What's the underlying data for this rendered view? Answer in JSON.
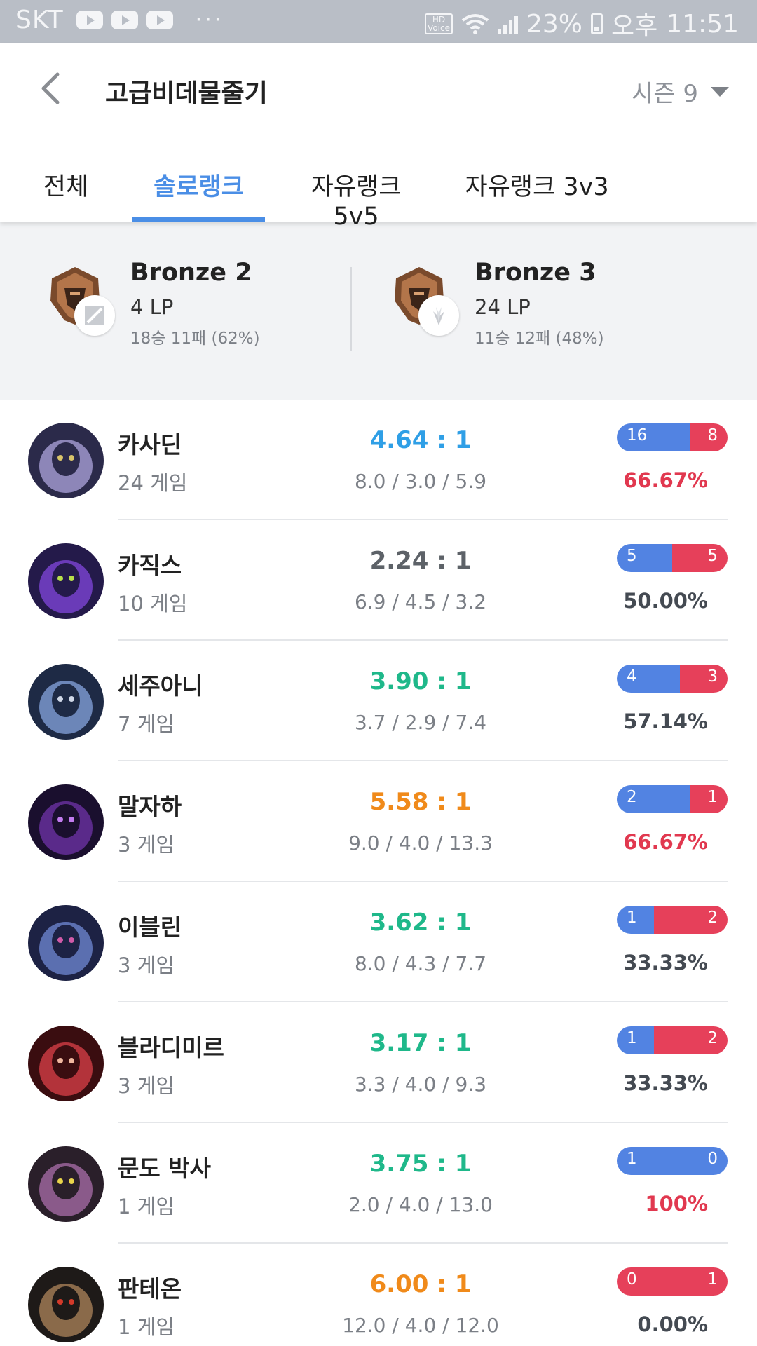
{
  "status_bar": {
    "carrier": "SKT",
    "more": "···",
    "hd_top": "HD",
    "hd_bottom": "Voice",
    "battery": "23%",
    "ampm": "오후",
    "time": "11:51"
  },
  "header": {
    "summoner_name": "고급비데물줄기",
    "season": "시즌 9"
  },
  "tabs": [
    {
      "label": "전체",
      "active": false
    },
    {
      "label": "솔로랭크",
      "active": true
    },
    {
      "label": "자유랭크 5v5",
      "active": false
    },
    {
      "label": "자유랭크 3v3",
      "active": false
    }
  ],
  "tiers": [
    {
      "name": "Bronze 2",
      "lp": "4 LP",
      "record": "18승 11패 (62%)",
      "queue_icon": "solo-queue-icon"
    },
    {
      "name": "Bronze 3",
      "lp": "24 LP",
      "record": "11승 12패 (48%)",
      "queue_icon": "flex-queue-icon"
    }
  ],
  "colors": {
    "accent": "#4a8ee6",
    "win": "#5283e2",
    "loss": "#e6405a",
    "kda_blue": "#2f9fe6",
    "kda_gray": "#5d6268",
    "kda_green": "#1fb88a",
    "kda_orange": "#f08a1a",
    "rate_red": "#e1384f",
    "rate_dark": "#444a52"
  },
  "champions": [
    {
      "name": "카사딘",
      "games": "24 게임",
      "kda_ratio": "4.64 : 1",
      "kda_color": "#2f9fe6",
      "kda": "8.0 / 3.0 / 5.9",
      "wins": 16,
      "losses": 8,
      "win_rate": "66.67%",
      "rate_color": "#e1384f",
      "avatar": "kassadin-portrait"
    },
    {
      "name": "카직스",
      "games": "10 게임",
      "kda_ratio": "2.24 : 1",
      "kda_color": "#5d6268",
      "kda": "6.9 / 4.5 / 3.2",
      "wins": 5,
      "losses": 5,
      "win_rate": "50.00%",
      "rate_color": "#444a52",
      "avatar": "khazix-portrait"
    },
    {
      "name": "세주아니",
      "games": "7 게임",
      "kda_ratio": "3.90 : 1",
      "kda_color": "#1fb88a",
      "kda": "3.7 / 2.9 / 7.4",
      "wins": 4,
      "losses": 3,
      "win_rate": "57.14%",
      "rate_color": "#444a52",
      "avatar": "sejuani-portrait"
    },
    {
      "name": "말자하",
      "games": "3 게임",
      "kda_ratio": "5.58 : 1",
      "kda_color": "#f08a1a",
      "kda": "9.0 / 4.0 / 13.3",
      "wins": 2,
      "losses": 1,
      "win_rate": "66.67%",
      "rate_color": "#e1384f",
      "avatar": "malzahar-portrait"
    },
    {
      "name": "이블린",
      "games": "3 게임",
      "kda_ratio": "3.62 : 1",
      "kda_color": "#1fb88a",
      "kda": "8.0 / 4.3 / 7.7",
      "wins": 1,
      "losses": 2,
      "win_rate": "33.33%",
      "rate_color": "#444a52",
      "avatar": "evelynn-portrait"
    },
    {
      "name": "블라디미르",
      "games": "3 게임",
      "kda_ratio": "3.17 : 1",
      "kda_color": "#1fb88a",
      "kda": "3.3 / 4.0 / 9.3",
      "wins": 1,
      "losses": 2,
      "win_rate": "33.33%",
      "rate_color": "#444a52",
      "avatar": "vladimir-portrait"
    },
    {
      "name": "문도 박사",
      "games": "1 게임",
      "kda_ratio": "3.75 : 1",
      "kda_color": "#1fb88a",
      "kda": "2.0 / 4.0 / 13.0",
      "wins": 1,
      "losses": 0,
      "win_rate": "100%",
      "rate_color": "#e1384f",
      "avatar": "drmundo-portrait"
    },
    {
      "name": "판테온",
      "games": "1 게임",
      "kda_ratio": "6.00 : 1",
      "kda_color": "#f08a1a",
      "kda": "12.0 / 4.0 / 12.0",
      "wins": 0,
      "losses": 1,
      "win_rate": "0.00%",
      "rate_color": "#444a52",
      "avatar": "pantheon-portrait"
    }
  ]
}
